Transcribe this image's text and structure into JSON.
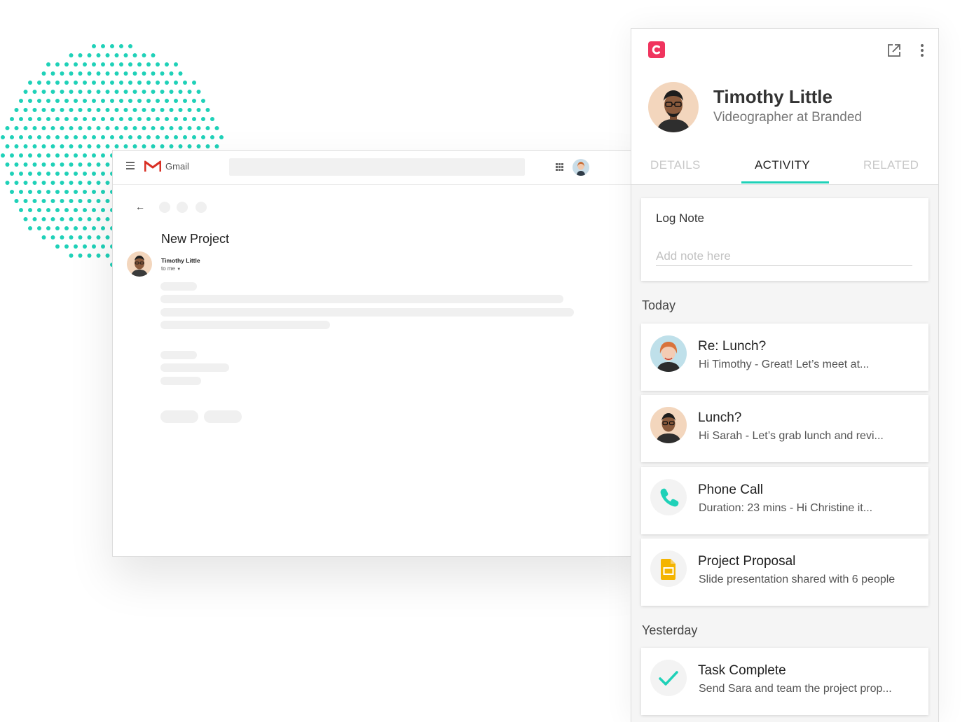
{
  "colors": {
    "accent": "#1fd1b8",
    "brand": "#f0345e",
    "gmail_red": "#d93025",
    "slides_yellow": "#f4b400"
  },
  "gmail": {
    "app_name": "Gmail",
    "email": {
      "subject": "New Project",
      "sender": "Timothy Little",
      "to_line": "to me"
    }
  },
  "crm": {
    "contact": {
      "name": "Timothy Little",
      "title": "Videographer at Branded"
    },
    "tabs": [
      {
        "label": "DETAILS"
      },
      {
        "label": "ACTIVITY"
      },
      {
        "label": "RELATED"
      }
    ],
    "active_tab": "ACTIVITY",
    "log_note": {
      "label": "Log Note",
      "placeholder": "Add note here"
    },
    "sections": {
      "today": "Today",
      "yesterday": "Yesterday"
    },
    "activities": [
      {
        "icon": "woman-avatar",
        "title": "Re: Lunch?",
        "desc": "Hi Timothy -  Great! Let’s meet at..."
      },
      {
        "icon": "man-avatar",
        "title": "Lunch?",
        "desc": "Hi Sarah - Let’s grab lunch and revi..."
      },
      {
        "icon": "phone-icon",
        "title": "Phone Call",
        "desc": "Duration: 23 mins -  Hi Christine it..."
      },
      {
        "icon": "slides-icon",
        "title": "Project Proposal",
        "desc": "Slide presentation shared with 6 people"
      },
      {
        "icon": "check-icon",
        "title": "Task Complete",
        "desc": "Send Sara and team the project prop..."
      }
    ]
  }
}
